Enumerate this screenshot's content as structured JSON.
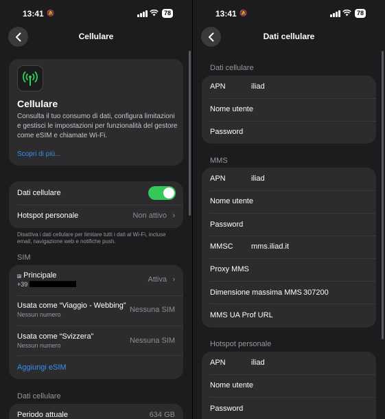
{
  "status_bar": {
    "time": "13:41",
    "battery": "78"
  },
  "left": {
    "title": "Cellulare",
    "info_card": {
      "title": "Cellulare",
      "description": "Consulta il tuo consumo di dati, configura limitazioni e gestisci le impostazioni per funzionalità del gestore come eSIM e chiamate Wi-Fi.",
      "link": "Scopri di più..."
    },
    "data_toggle": {
      "label": "Dati cellulare",
      "on": true
    },
    "hotspot": {
      "label": "Hotspot personale",
      "value": "Non attivo"
    },
    "footer_note": "Disattiva i dati cellulare per limitare tutti i dati al Wi-Fi, incluse email, navigazione web e notifiche push.",
    "sim_header": "SIM",
    "sims": [
      {
        "tag": "P",
        "name": "Principale",
        "number": "+39",
        "status": "Attiva"
      },
      {
        "name": "Usata come “Viaggio - Webbing”",
        "subtitle": "Nessun numero",
        "status": "Nessuna SIM"
      },
      {
        "name": "Usata come “Svizzera”",
        "subtitle": "Nessun numero",
        "status": "Nessuna SIM"
      }
    ],
    "add_esim": "Aggiungi eSIM",
    "data_header": "Dati cellulare",
    "current_period": {
      "label": "Periodo attuale",
      "value": "634 GB"
    }
  },
  "right": {
    "title": "Dati cellulare",
    "sections": [
      {
        "header": "Dati cellulare",
        "rows": [
          {
            "label": "APN",
            "value": "iliad"
          },
          {
            "label": "Nome utente",
            "value": ""
          },
          {
            "label": "Password",
            "value": ""
          }
        ]
      },
      {
        "header": "MMS",
        "rows": [
          {
            "label": "APN",
            "value": "iliad"
          },
          {
            "label": "Nome utente",
            "value": ""
          },
          {
            "label": "Password",
            "value": ""
          },
          {
            "label": "MMSC",
            "value": "mms.iliad.it"
          },
          {
            "label": "Proxy MMS",
            "value": ""
          },
          {
            "label": "Dimensione massima MMS",
            "value": "307200"
          },
          {
            "label": "MMS UA Prof URL",
            "value": ""
          }
        ]
      },
      {
        "header": "Hotspot personale",
        "rows": [
          {
            "label": "APN",
            "value": "iliad"
          },
          {
            "label": "Nome utente",
            "value": ""
          },
          {
            "label": "Password",
            "value": ""
          }
        ]
      }
    ]
  },
  "colors": {
    "accent": "#3b8ef5",
    "toggle_on": "#34c759",
    "antenna_icon": "#30d158"
  },
  "icons": [
    "back-chevron-icon",
    "antenna-icon",
    "chevron-right-icon",
    "wifi-icon",
    "signal-icon",
    "silent-bell-icon"
  ]
}
